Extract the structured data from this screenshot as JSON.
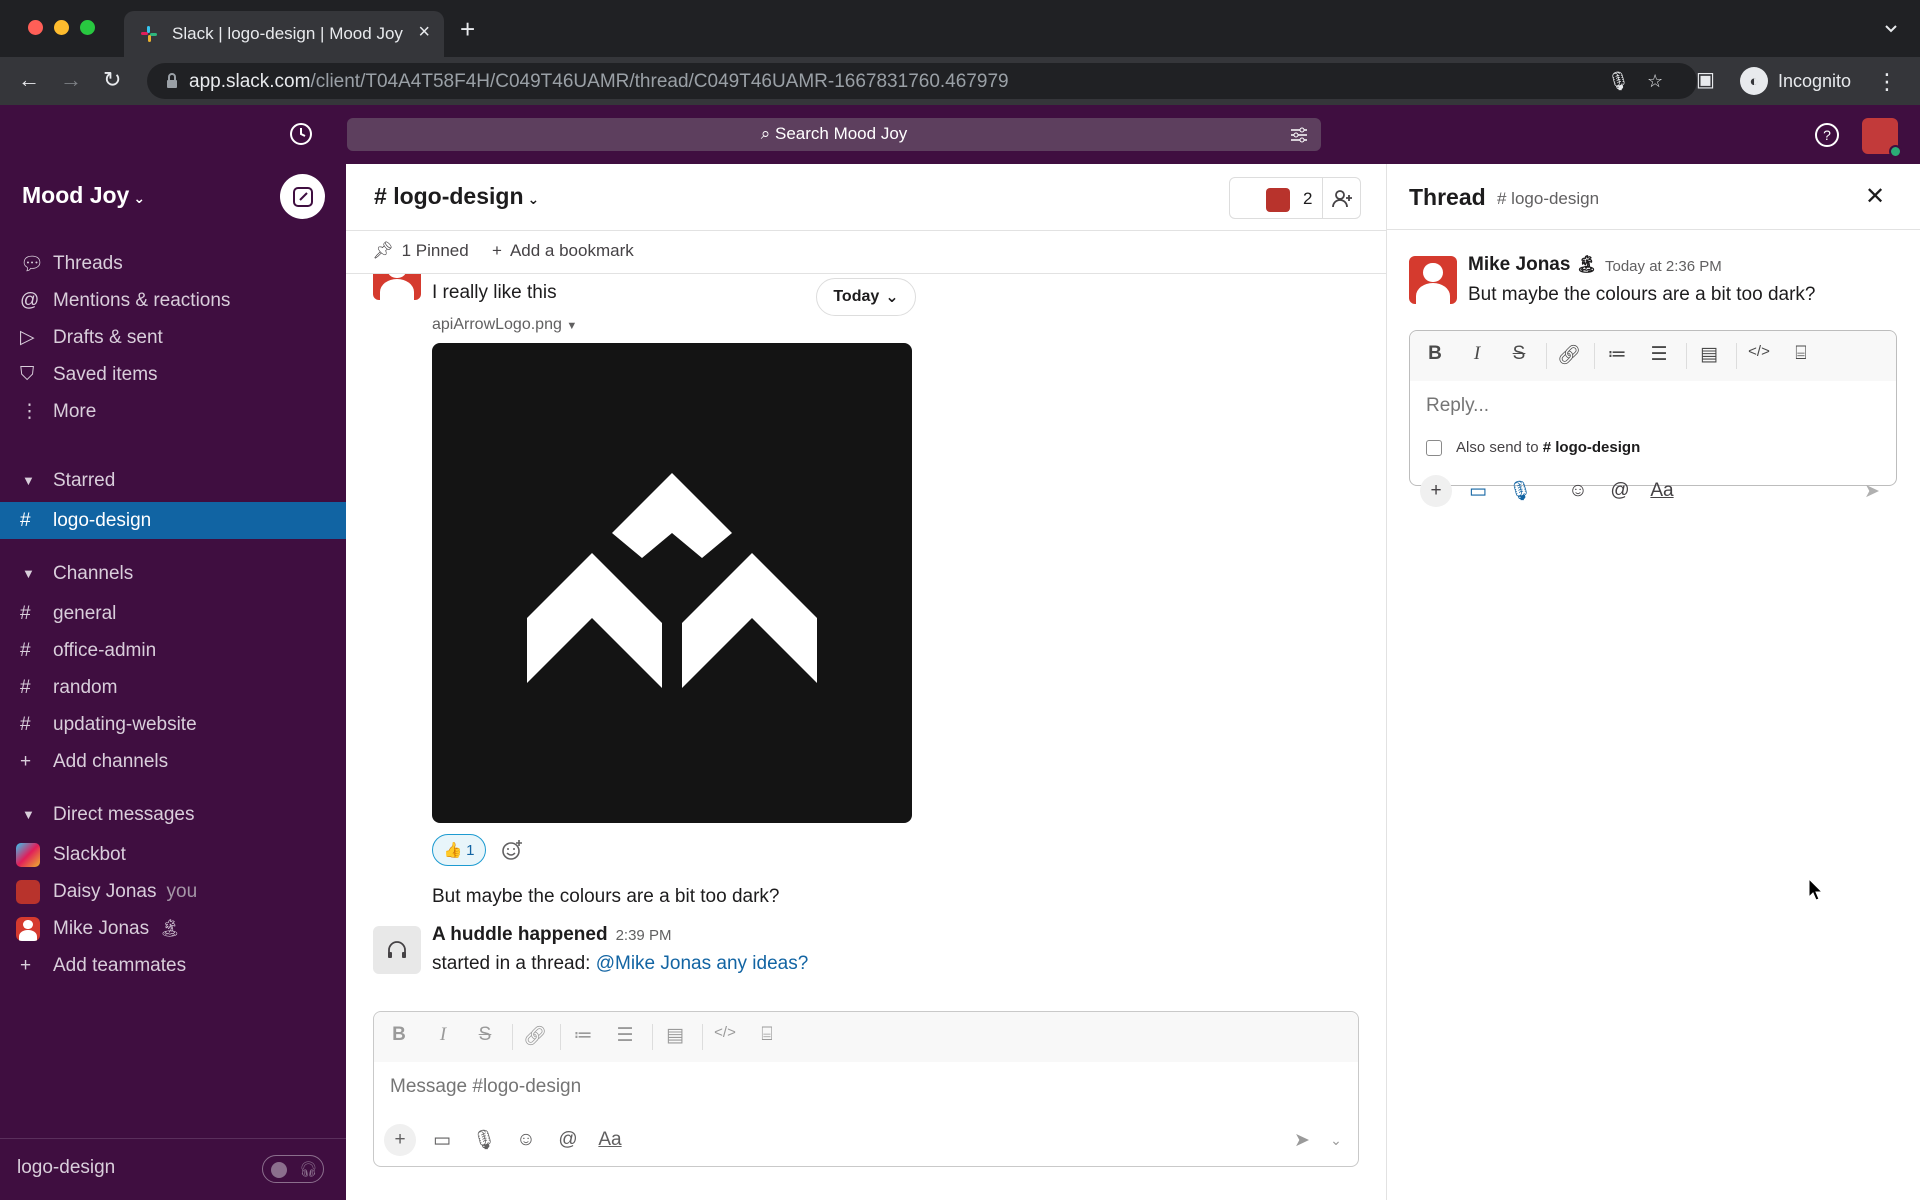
{
  "browser": {
    "tab_title": "Slack | logo-design | Mood Joy",
    "url_host": "app.slack.com",
    "url_path": "/client/T04A4T58F4H/C049T46UAMR/thread/C049T46UAMR-1667831760.467979",
    "incognito_label": "Incognito"
  },
  "topbar": {
    "search_placeholder": "Search Mood Joy"
  },
  "sidebar": {
    "workspace": "Mood Joy",
    "nav": [
      {
        "label": "Threads",
        "icon": "threads-icon"
      },
      {
        "label": "Mentions & reactions",
        "icon": "at-icon"
      },
      {
        "label": "Drafts & sent",
        "icon": "send-icon"
      },
      {
        "label": "Saved items",
        "icon": "bookmark-icon"
      },
      {
        "label": "More",
        "icon": "more-vertical-icon"
      }
    ],
    "starred_header": "Starred",
    "starred": [
      {
        "label": "logo-design",
        "active": true
      }
    ],
    "channels_header": "Channels",
    "channels": [
      {
        "label": "general"
      },
      {
        "label": "office-admin"
      },
      {
        "label": "random"
      },
      {
        "label": "updating-website"
      }
    ],
    "add_channels": "Add channels",
    "dm_header": "Direct messages",
    "dms": [
      {
        "label": "Slackbot",
        "suffix": ""
      },
      {
        "label": "Daisy Jonas",
        "suffix": "you"
      },
      {
        "label": "Mike Jonas",
        "suffix": "🏝"
      }
    ],
    "add_teammates": "Add teammates",
    "footer_label": "logo-design"
  },
  "channel": {
    "name": "logo-design",
    "member_count": "2",
    "pinned": "1 Pinned",
    "add_bookmark": "Add a bookmark",
    "today_label": "Today",
    "messages": {
      "first_text": "I really like this",
      "filename": "apiArrowLogo.png",
      "reaction_emoji": "👍",
      "reaction_count": "1",
      "second_text": "But maybe the colours are a bit too dark?",
      "huddle_title": "A huddle happened",
      "huddle_time": "2:39 PM",
      "huddle_prefix": "started in a thread:",
      "huddle_link": "@Mike Jonas any ideas?"
    },
    "composer_placeholder": "Message #logo-design"
  },
  "thread": {
    "title": "Thread",
    "channel": "# logo-design",
    "author": "Mike Jonas",
    "author_status_emoji": "🏝",
    "time": "Today at 2:36 PM",
    "text": "But maybe the colours are a bit too dark?",
    "reply_placeholder": "Reply...",
    "also_send_prefix": "Also send to",
    "also_send_channel": "# logo-design"
  },
  "colors": {
    "sidebar_bg": "#3f0e40",
    "active_item": "#1164a3",
    "link": "#1264a3"
  }
}
